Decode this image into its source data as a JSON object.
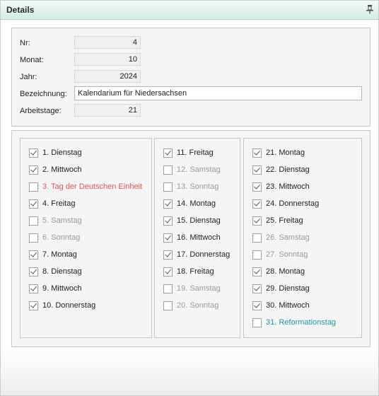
{
  "panel": {
    "title": "Details",
    "pin_icon": "pin-icon"
  },
  "fields": {
    "nr": {
      "label": "Nr:",
      "value": "4"
    },
    "monat": {
      "label": "Monat:",
      "value": "10"
    },
    "jahr": {
      "label": "Jahr:",
      "value": "2024"
    },
    "bezeichnung": {
      "label": "Bezeichnung:",
      "value": "Kalendarium für Niedersachsen"
    },
    "arbeitstage": {
      "label": "Arbeitstage:",
      "value": "21"
    }
  },
  "colors": {
    "normal": "#222222",
    "weekend": "#9a9a9a",
    "holiday_red": "#e05353",
    "holiday_teal": "#1f97a8"
  },
  "columns": [
    [
      {
        "label": "1. Dienstag",
        "checked": true,
        "kind": "normal"
      },
      {
        "label": "2. Mittwoch",
        "checked": true,
        "kind": "normal"
      },
      {
        "label": "3. Tag der Deutschen Einheit",
        "checked": false,
        "kind": "holiday-red"
      },
      {
        "label": "4. Freitag",
        "checked": true,
        "kind": "normal"
      },
      {
        "label": "5. Samstag",
        "checked": false,
        "kind": "weekend"
      },
      {
        "label": "6. Sonntag",
        "checked": false,
        "kind": "weekend"
      },
      {
        "label": "7. Montag",
        "checked": true,
        "kind": "normal"
      },
      {
        "label": "8. Dienstag",
        "checked": true,
        "kind": "normal"
      },
      {
        "label": "9. Mittwoch",
        "checked": true,
        "kind": "normal"
      },
      {
        "label": "10. Donnerstag",
        "checked": true,
        "kind": "normal"
      }
    ],
    [
      {
        "label": "11. Freitag",
        "checked": true,
        "kind": "normal"
      },
      {
        "label": "12. Samstag",
        "checked": false,
        "kind": "weekend"
      },
      {
        "label": "13. Sonntag",
        "checked": false,
        "kind": "weekend"
      },
      {
        "label": "14. Montag",
        "checked": true,
        "kind": "normal"
      },
      {
        "label": "15. Dienstag",
        "checked": true,
        "kind": "normal"
      },
      {
        "label": "16. Mittwoch",
        "checked": true,
        "kind": "normal"
      },
      {
        "label": "17. Donnerstag",
        "checked": true,
        "kind": "normal"
      },
      {
        "label": "18. Freitag",
        "checked": true,
        "kind": "normal"
      },
      {
        "label": "19. Samstag",
        "checked": false,
        "kind": "weekend"
      },
      {
        "label": "20. Sonntag",
        "checked": false,
        "kind": "weekend"
      }
    ],
    [
      {
        "label": "21. Montag",
        "checked": true,
        "kind": "normal"
      },
      {
        "label": "22. Dienstag",
        "checked": true,
        "kind": "normal"
      },
      {
        "label": "23. Mittwoch",
        "checked": true,
        "kind": "normal"
      },
      {
        "label": "24. Donnerstag",
        "checked": true,
        "kind": "normal"
      },
      {
        "label": "25. Freitag",
        "checked": true,
        "kind": "normal"
      },
      {
        "label": "26. Samstag",
        "checked": false,
        "kind": "weekend"
      },
      {
        "label": "27. Sonntag",
        "checked": false,
        "kind": "weekend"
      },
      {
        "label": "28. Montag",
        "checked": true,
        "kind": "normal"
      },
      {
        "label": "29. Dienstag",
        "checked": true,
        "kind": "normal"
      },
      {
        "label": "30. Mittwoch",
        "checked": true,
        "kind": "normal"
      },
      {
        "label": "31. Reformationstag",
        "checked": false,
        "kind": "holiday-teal"
      }
    ]
  ]
}
